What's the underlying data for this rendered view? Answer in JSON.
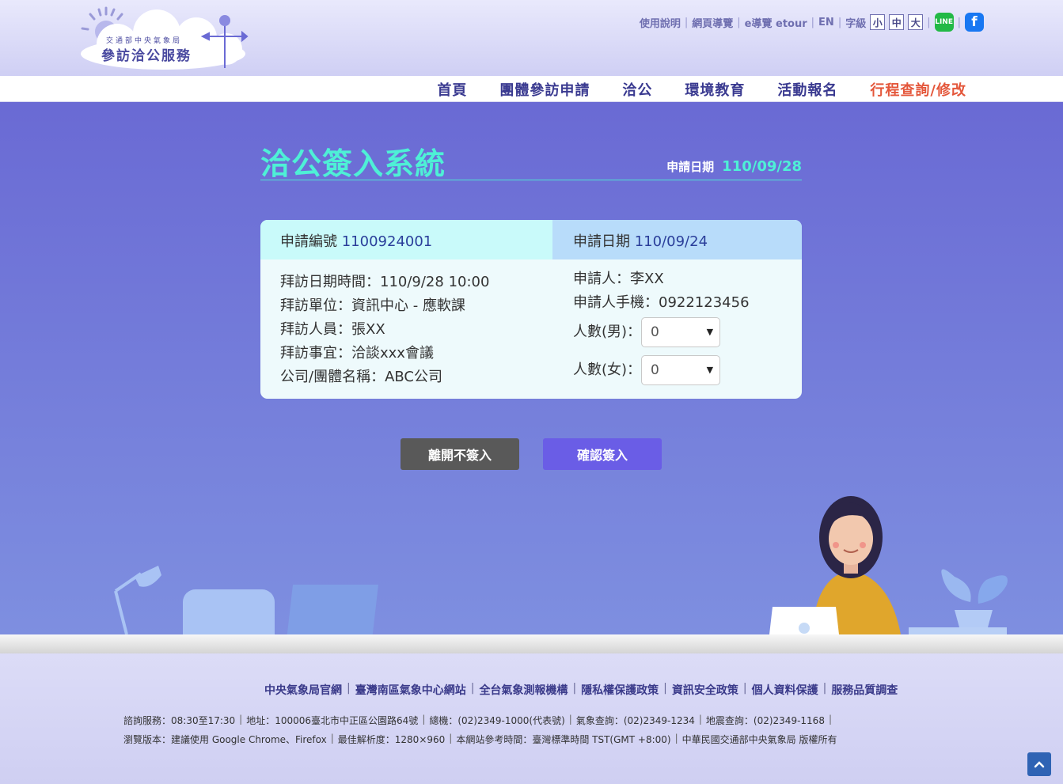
{
  "header": {
    "logo": {
      "line1": "交通部中央氣象局",
      "line2": "參訪洽公服務"
    },
    "util_links": [
      "使用說明",
      "網頁導覽",
      "e導覽 etour",
      "EN"
    ],
    "font_size_label": "字級",
    "font_sizes": [
      "小",
      "中",
      "大"
    ],
    "social": {
      "line": "LINE",
      "facebook": "f"
    }
  },
  "nav": {
    "items": [
      "首頁",
      "團體參訪申請",
      "洽公",
      "環境教育",
      "活動報名",
      "行程查詢/修改"
    ],
    "active_index": 5
  },
  "page": {
    "title": "洽公簽入系統",
    "apply_date_label": "申請日期",
    "apply_date_value": "110/09/28"
  },
  "card": {
    "number_label": "申請編號",
    "number_value": "1100924001",
    "date_label": "申請日期",
    "date_value": "110/09/24",
    "left_rows": [
      "拜訪日期時間：110/9/28 10:00",
      "拜訪單位：資訊中心 - 應軟課",
      "拜訪人員：張XX",
      "拜訪事宜：洽談xxx會議",
      "公司/團體名稱：ABC公司"
    ],
    "applicant": "申請人：李XX",
    "phone": "申請人手機：0922123456",
    "male_label": "人數(男)：",
    "male_value": "0",
    "female_label": "人數(女)：",
    "female_value": "0"
  },
  "buttons": {
    "leave": "離開不簽入",
    "confirm": "確認簽入"
  },
  "footer": {
    "links": [
      "中央氣象局官網",
      "臺灣南區氣象中心網站",
      "全台氣象測報機構",
      "隱私權保護政策",
      "資訊安全政策",
      "個人資料保護",
      "服務品質調查"
    ],
    "info_line1": [
      "諮詢服務：08:30至17:30",
      "地址：100006臺北市中正區公園路64號",
      "總機：(02)2349-1000(代表號)",
      "氣象查詢：(02)2349-1234",
      "地震查詢：(02)2349-1168"
    ],
    "info_line2": [
      "瀏覽版本：建議使用 Google Chrome、Firefox",
      "最佳解析度：1280×960",
      "本網站參考時間：臺灣標準時間 TST(GMT +8:00)",
      "中華民國交通部中央氣象局 版權所有"
    ]
  },
  "colors": {
    "accent": "#4ef0d6",
    "nav_active": "#e4573b",
    "confirm": "#6a5de6",
    "leave": "#595959"
  }
}
